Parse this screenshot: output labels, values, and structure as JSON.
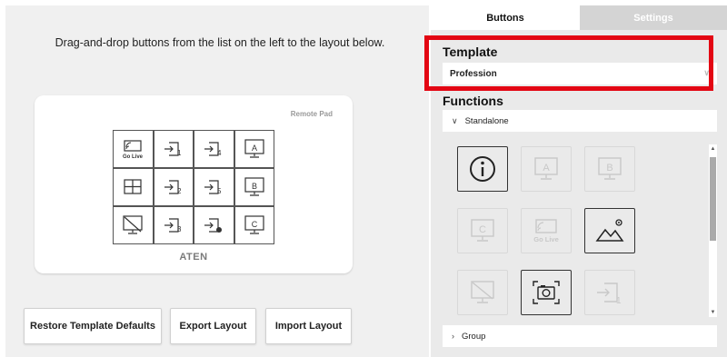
{
  "left_panel": {
    "instructions": "Drag-and-drop buttons from the list on the left to the layout below.",
    "pad": {
      "name": "Remote Pad",
      "brand": "ATEN",
      "keys": [
        {
          "icon": "go-live-icon",
          "label": "Go Live"
        },
        {
          "icon": "input-1-icon",
          "label": "1"
        },
        {
          "icon": "input-4-icon",
          "label": "4"
        },
        {
          "icon": "display-a-icon",
          "label": "A"
        },
        {
          "icon": "grid-layout-icon",
          "label": ""
        },
        {
          "icon": "input-2-icon",
          "label": "2"
        },
        {
          "icon": "input-5-icon",
          "label": "5"
        },
        {
          "icon": "display-b-icon",
          "label": "B"
        },
        {
          "icon": "display-off-icon",
          "label": ""
        },
        {
          "icon": "input-3-icon",
          "label": "3"
        },
        {
          "icon": "input-record-icon",
          "label": ""
        },
        {
          "icon": "display-c-icon",
          "label": "C"
        }
      ]
    },
    "actions": {
      "restore": "Restore Template Defaults",
      "export": "Export Layout",
      "import": "Import Layout"
    }
  },
  "right_panel": {
    "tabs": {
      "buttons": "Buttons",
      "settings": "Settings",
      "active": "Buttons"
    },
    "template": {
      "title": "Template",
      "value": "Profession"
    },
    "functions": {
      "title": "Functions",
      "standalone_label": "Standalone",
      "group_label": "Group",
      "palette": [
        {
          "icon": "info-icon",
          "label": "",
          "enabled": true
        },
        {
          "icon": "display-a-icon",
          "label": "A",
          "enabled": false
        },
        {
          "icon": "display-b-icon",
          "label": "B",
          "enabled": false
        },
        {
          "icon": "display-c-icon",
          "label": "C",
          "enabled": false
        },
        {
          "icon": "go-live-icon",
          "label": "Go Live",
          "enabled": false
        },
        {
          "icon": "image-icon",
          "label": "",
          "enabled": true
        },
        {
          "icon": "display-off-icon",
          "label": "",
          "enabled": false
        },
        {
          "icon": "snapshot-icon",
          "label": "",
          "enabled": true
        },
        {
          "icon": "input-1-icon",
          "label": "1",
          "enabled": false
        }
      ]
    }
  },
  "colors": {
    "highlight": "#e30613",
    "panel": "#f0f0f0",
    "sidebar": "#eaeaea"
  }
}
